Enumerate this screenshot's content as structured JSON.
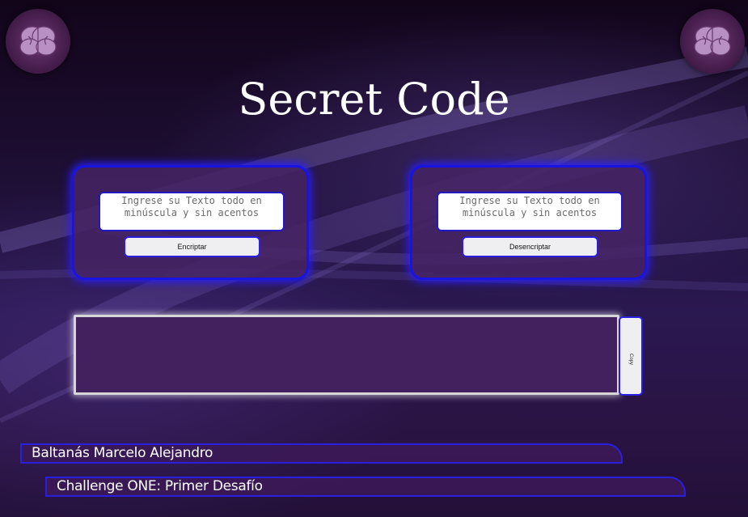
{
  "app": {
    "title": "Secret Code"
  },
  "encrypt": {
    "placeholder": "Ingrese su Texto todo en minúscula y sin acentos",
    "button_label": "Encriptar"
  },
  "decrypt": {
    "placeholder": "Ingrese su Texto todo en minúscula y sin acentos",
    "button_label": "Desencriptar"
  },
  "output": {
    "value": "",
    "copy_label": "Copy"
  },
  "footer": {
    "author": "Baltanás Marcelo Alejandro",
    "challenge": "Challenge ONE: Primer Desafío"
  },
  "icons": {
    "logo": "brain-icon"
  },
  "colors": {
    "accent_border": "#1a14e0",
    "panel_bg": "#46235f",
    "background": "#1e0f35"
  }
}
